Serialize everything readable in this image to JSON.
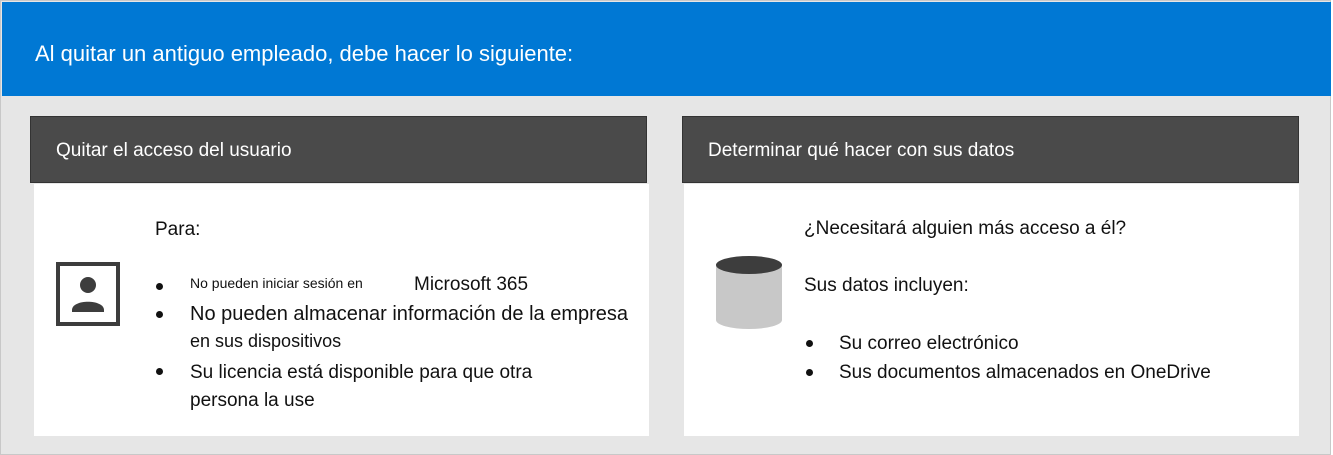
{
  "banner": {
    "title": "Al quitar un antiguo empleado, debe hacer lo siguiente:"
  },
  "left_panel": {
    "header": "Quitar el acceso del usuario",
    "icon": "user-profile-icon",
    "intro": "Para:",
    "items": [
      {
        "small": "No pueden iniciar sesión en",
        "large": "Microsoft 365"
      },
      {
        "line1": "No pueden almacenar información de la empresa",
        "line2": "en sus dispositivos"
      },
      {
        "line1": "Su licencia está disponible para que otra",
        "line2": "persona la use"
      }
    ]
  },
  "right_panel": {
    "header": "Determinar qué hacer con sus datos",
    "icon": "database-icon",
    "question": "¿Necesitará alguien más acceso a él?",
    "intro": "Sus datos incluyen:",
    "items": [
      "Su correo electrónico",
      "Sus documentos almacenados en OneDrive"
    ]
  },
  "colors": {
    "banner": "#0078d4",
    "panel_header": "#4a4a4a",
    "background": "#e6e6e6",
    "icon_dark": "#3d3d3d",
    "icon_light": "#c8c8c8"
  }
}
